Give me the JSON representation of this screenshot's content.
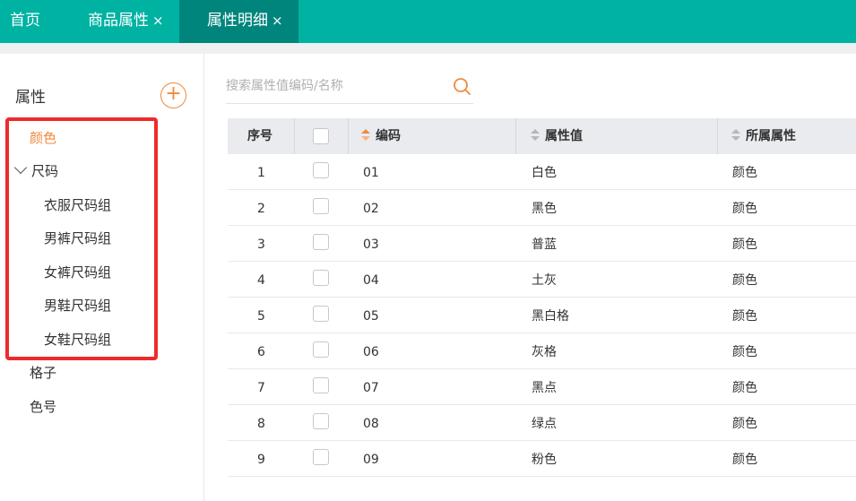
{
  "tabs": [
    {
      "label": "首页",
      "closable": false,
      "active": false
    },
    {
      "label": "商品属性",
      "closable": true,
      "active": false
    },
    {
      "label": "属性明细",
      "closable": true,
      "active": true
    }
  ],
  "tab_close_glyph": "×",
  "colors": {
    "topbar": "#00b2a2",
    "active_tab": "#00857d",
    "accent": "#f08a3c",
    "highlight_box": "#ee2a2a"
  },
  "sidebar": {
    "title": "属性",
    "add_glyph": "+",
    "tree": [
      {
        "label": "颜色",
        "active": true
      },
      {
        "label": "尺码",
        "expanded": true,
        "children": [
          {
            "label": "衣服尺码组"
          },
          {
            "label": "男裤尺码组"
          },
          {
            "label": "女裤尺码组"
          },
          {
            "label": "男鞋尺码组"
          },
          {
            "label": "女鞋尺码组"
          }
        ]
      },
      {
        "label": "格子"
      },
      {
        "label": "色号"
      }
    ]
  },
  "search": {
    "placeholder": "搜索属性值编码/名称",
    "value": "",
    "icon": "search-icon"
  },
  "table": {
    "columns": [
      "序号",
      "",
      "编码",
      "属性值",
      "所属属性"
    ],
    "sort_active_column": "编码",
    "rows": [
      {
        "index": "1",
        "code": "01",
        "value": "白色",
        "attribute": "颜色"
      },
      {
        "index": "2",
        "code": "02",
        "value": "黑色",
        "attribute": "颜色"
      },
      {
        "index": "3",
        "code": "03",
        "value": "普蓝",
        "attribute": "颜色"
      },
      {
        "index": "4",
        "code": "04",
        "value": "土灰",
        "attribute": "颜色"
      },
      {
        "index": "5",
        "code": "05",
        "value": "黑白格",
        "attribute": "颜色"
      },
      {
        "index": "6",
        "code": "06",
        "value": "灰格",
        "attribute": "颜色"
      },
      {
        "index": "7",
        "code": "07",
        "value": "黑点",
        "attribute": "颜色"
      },
      {
        "index": "8",
        "code": "08",
        "value": "绿点",
        "attribute": "颜色"
      },
      {
        "index": "9",
        "code": "09",
        "value": "粉色",
        "attribute": "颜色"
      }
    ]
  }
}
